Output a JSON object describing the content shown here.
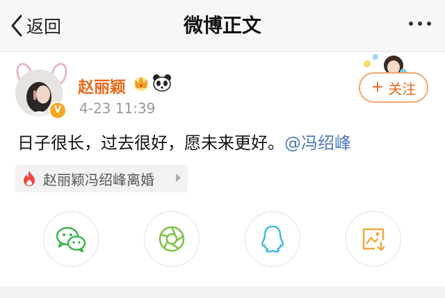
{
  "nav": {
    "back_label": "返回",
    "title": "微博正文"
  },
  "post": {
    "username": "赵丽颖",
    "timestamp": "4-23 11:39",
    "text_main": "日子很长，过去很好，愿未来更好。",
    "mention": "@冯绍峰",
    "follow_label": "关注",
    "follow_plus": "+",
    "topic": "赵丽颖冯绍峰离婚"
  },
  "share": [
    {
      "name": "wechat-icon"
    },
    {
      "name": "moments-icon"
    },
    {
      "name": "qq-icon"
    },
    {
      "name": "save-image-icon"
    }
  ],
  "colors": {
    "username": "#e8681a",
    "mention": "#4a7ab8",
    "wechat": "#3cb54a",
    "moments": "#7ac142",
    "qq": "#3fb6e8",
    "save": "#f3a83b"
  }
}
